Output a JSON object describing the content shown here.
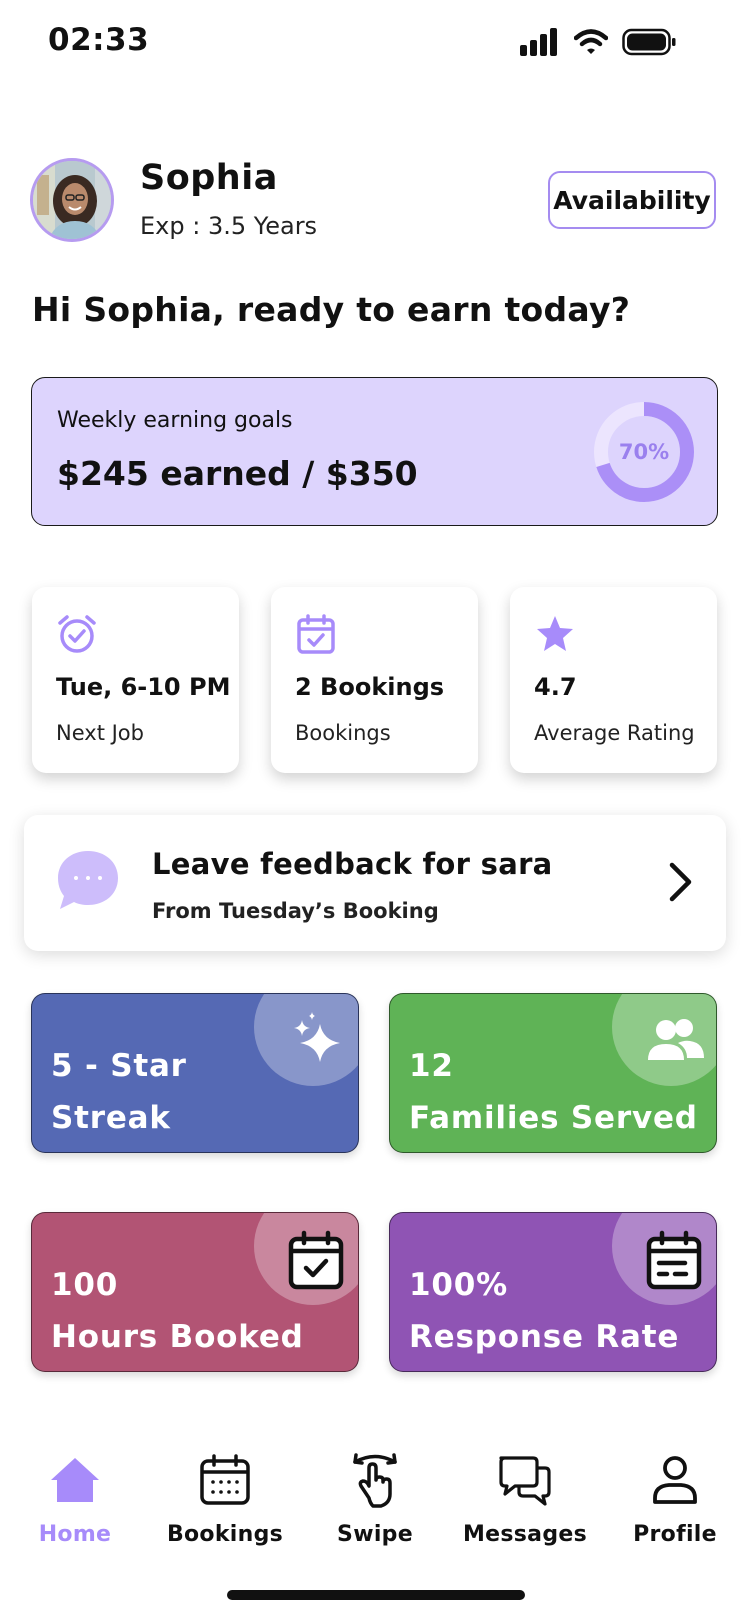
{
  "status_bar": {
    "time": "02:33"
  },
  "profile": {
    "name": "Sophia",
    "experience": "Exp : 3.5 Years",
    "availability_label": "Availability"
  },
  "greeting": "Hi Sophia, ready to earn today?",
  "earnings": {
    "label": "Weekly earning goals",
    "value": "$245 earned / $350",
    "percent_label": "70%",
    "progress": 0.7
  },
  "stats": [
    {
      "icon": "alarm-clock-icon",
      "value": "Tue, 6-10 PM",
      "label": "Next Job"
    },
    {
      "icon": "calendar-check-icon",
      "value": "2 Bookings",
      "label": "Bookings"
    },
    {
      "icon": "star-icon",
      "value": "4.7",
      "label": "Average Rating"
    }
  ],
  "feedback": {
    "title": "Leave feedback for sara",
    "subtitle": "From Tuesday’s Booking"
  },
  "tiles": [
    {
      "line1": "5 - Star",
      "line2": "Streak",
      "color": "#5569b4",
      "icon": "sparkles-icon"
    },
    {
      "line1": "12",
      "line2": "Families Served",
      "color": "#5fb356",
      "icon": "users-icon"
    },
    {
      "line1": "100",
      "line2": "Hours Booked",
      "color": "#b25474",
      "icon": "calendar-check-icon"
    },
    {
      "line1": "100%",
      "line2": "Response Rate",
      "color": "#8f54b4",
      "icon": "calendar-list-icon"
    }
  ],
  "nav": [
    {
      "label": "Home",
      "active": true
    },
    {
      "label": "Bookings",
      "active": false
    },
    {
      "label": "Swipe",
      "active": false
    },
    {
      "label": "Messages",
      "active": false
    },
    {
      "label": "Profile",
      "active": false
    }
  ],
  "colors": {
    "accent": "#a78bfa",
    "accent_dark": "#9a80ee",
    "earnings_bg": "#ddd4fd"
  }
}
